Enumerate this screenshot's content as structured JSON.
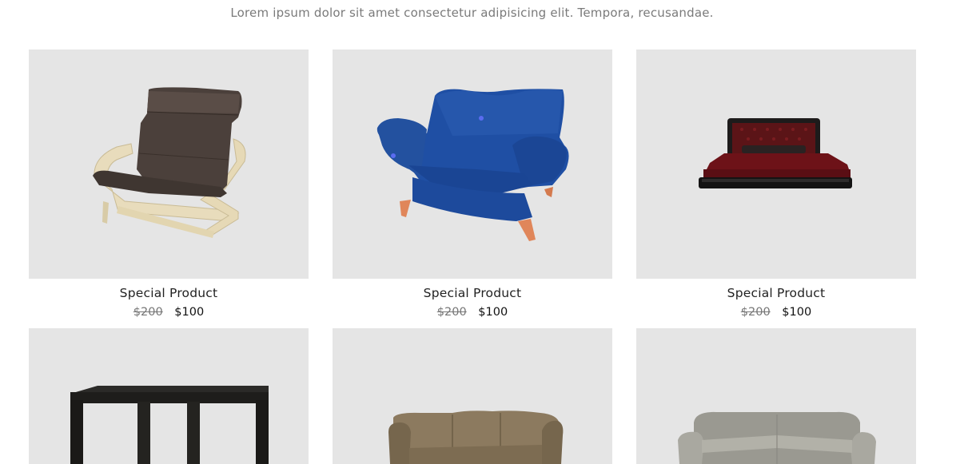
{
  "header": {
    "subtitle": "Lorem ipsum dolor sit amet consectetur adipisicing elit. Tempora, recusandae."
  },
  "products": [
    {
      "image": "chair-icon",
      "name": "Special Product",
      "old_price": "$200",
      "price": "$100"
    },
    {
      "image": "armchair-icon",
      "name": "Special Product",
      "old_price": "$200",
      "price": "$100"
    },
    {
      "image": "bed-icon",
      "name": "Special Product",
      "old_price": "$200",
      "price": "$100"
    },
    {
      "image": "table-icon"
    },
    {
      "image": "sofa-icon"
    },
    {
      "image": "couch-icon"
    }
  ]
}
